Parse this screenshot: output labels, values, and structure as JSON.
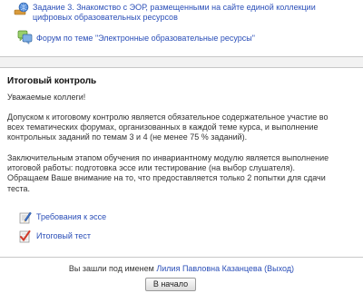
{
  "activities": [
    {
      "icon": "resource-link-icon",
      "lines": [
        "Задание 3. Знакомство с ЭОР, размещенными на сайте единой коллекции",
        "цифровых образовательных ресурсов"
      ]
    },
    {
      "icon": "forum-icon",
      "lines": [
        "Форум по теме \"Электронные образовательные ресурсы\""
      ]
    }
  ],
  "section": {
    "title": "Итоговый контроль",
    "greeting": "Уважаемые коллеги!",
    "paragraph1": [
      "Допуском к итоговому контролю является обязательное содержательное участие во",
      "всех тематических форумах, организованных в каждой теме курса, и выполнение",
      "контрольных заданий по темам 3 и 4 (не менее 75 % заданий)."
    ],
    "paragraph2": [
      "Заключительным этапом обучения по инвариантному модулю является выполнение",
      "итоговой работы: подготовка эссе или тестирование (на выбор слушателя).",
      "Обращаем Ваше внимание на то, что предоставляется только 2 попытки для сдачи",
      "теста."
    ],
    "links": [
      {
        "icon": "assignment-icon",
        "label": "Требования к эссе"
      },
      {
        "icon": "quiz-icon",
        "label": "Итоговый тест"
      }
    ]
  },
  "footer": {
    "logged_in_prefix": "Вы зашли под именем",
    "user_name": "Лилия Павловна Казанцева",
    "logout_label": "(Выход)",
    "home_button": "В начало"
  },
  "colors": {
    "link": "#2b4fb8",
    "separator_band": "#f2f2f2",
    "border": "#c8c8c8"
  }
}
